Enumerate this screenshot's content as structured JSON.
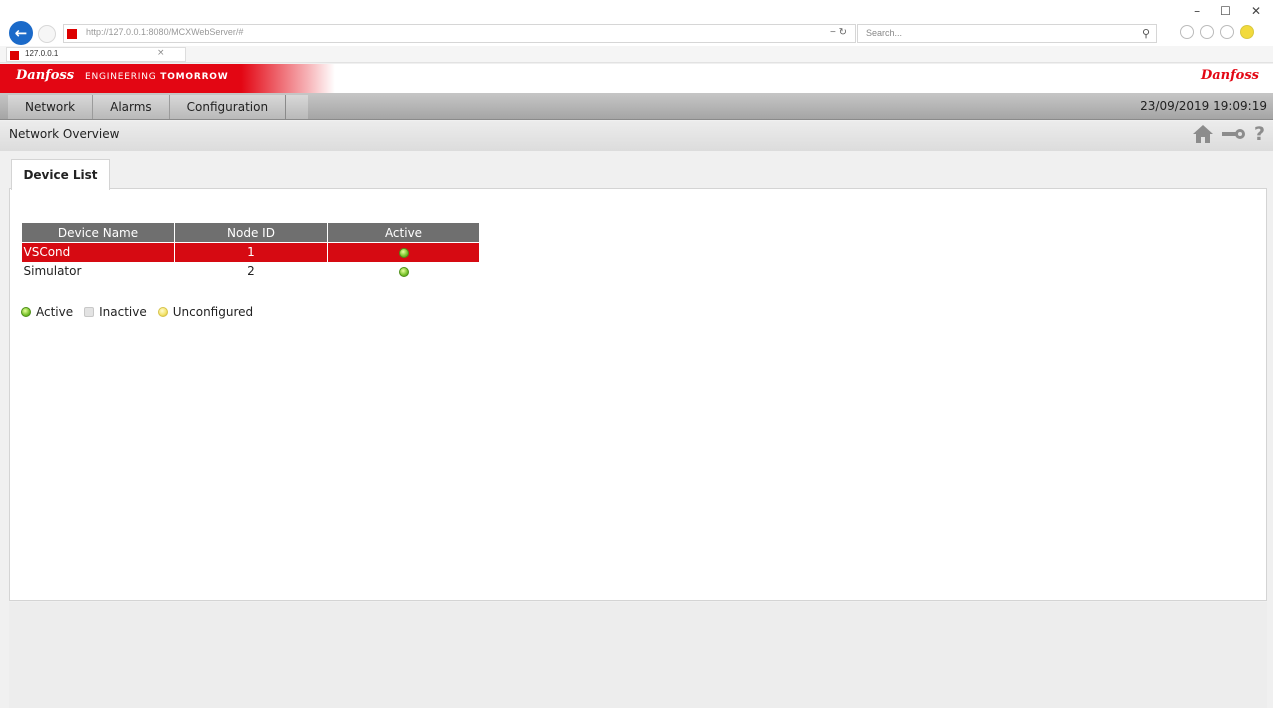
{
  "browser": {
    "url": "http://127.0.0.1:8080/MCXWebServer/#",
    "search_placeholder": "Search...",
    "tab_title": "127.0.0.1",
    "window_controls": {
      "minimize": "–",
      "restore": "☐",
      "close": "✕"
    }
  },
  "brand": {
    "logo": "Danfoss",
    "tagline_prefix": "ENGINEERING",
    "tagline_suffix": "TOMORROW",
    "logo_right": "Danfoss",
    "color": "#e30613"
  },
  "nav": {
    "items": [
      {
        "label": "Network"
      },
      {
        "label": "Alarms"
      },
      {
        "label": "Configuration"
      }
    ],
    "datetime": "23/09/2019 19:09:19"
  },
  "page": {
    "title": "Network Overview",
    "icons": [
      "home-icon",
      "key-icon",
      "help-icon"
    ],
    "help_glyph": "?"
  },
  "device_list": {
    "tab_label": "Device List",
    "columns": [
      "Device Name",
      "Node ID",
      "Active"
    ],
    "rows": [
      {
        "name": "VSCond",
        "node_id": "1",
        "active": "active",
        "selected": true
      },
      {
        "name": "Simulator",
        "node_id": "2",
        "active": "active",
        "selected": false
      }
    ]
  },
  "legend": {
    "active": "Active",
    "inactive": "Inactive",
    "unconfigured": "Unconfigured"
  }
}
